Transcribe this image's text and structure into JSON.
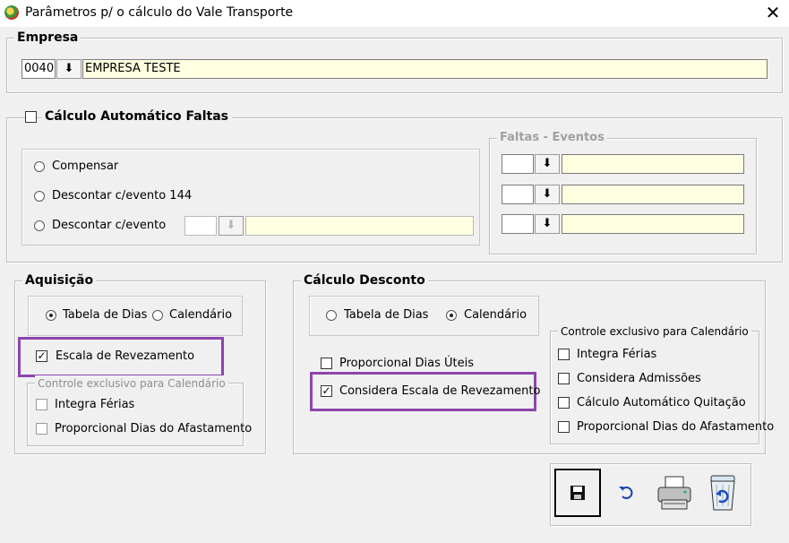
{
  "window": {
    "title": "Parâmetros p/ o cálculo do Vale Transporte",
    "close_glyph": "✕"
  },
  "empresa": {
    "legend": "Empresa",
    "code": "0040",
    "name": "EMPRESA TESTE",
    "lookup_icon": "⬇"
  },
  "faltas": {
    "checkbox_label": "Cálculo Automático Faltas",
    "checked": false,
    "options": [
      "Compensar",
      "Descontar c/evento 144",
      "Descontar c/evento"
    ],
    "eventos_legend": "Faltas - Eventos"
  },
  "aquisicao": {
    "legend": "Aquisição",
    "option_tabela": "Tabela de Dias",
    "option_calendario": "Calendário",
    "selected": "Tabela de Dias",
    "escala_label": "Escala de Revezamento",
    "escala_checked": true,
    "controle_legend": "Controle exclusivo para Calendário",
    "integra_ferias": "Integra Férias",
    "proporcional_afastamento": "Proporcional Dias do Afastamento"
  },
  "calculo_desconto": {
    "legend": "Cálculo Desconto",
    "option_tabela": "Tabela de Dias",
    "option_calendario": "Calendário",
    "selected": "Calendário",
    "proporcional_uteis": "Proporcional Dias Úteis",
    "considera_escala": "Considera Escala de Revezamento",
    "considera_escala_checked": true,
    "controle_legend": "Controle exclusivo para Calendário",
    "integra_ferias": "Integra Férias",
    "considera_admissoes": "Considera Admissões",
    "calculo_quitacao": "Cálculo Automático Quitação",
    "proporcional_afastamento": "Proporcional Dias do Afastamento"
  },
  "toolbar": {
    "save": "save-icon",
    "undo": "undo-icon",
    "print": "printer-icon",
    "recycle": "recycle-bin-icon"
  },
  "colors": {
    "highlight": "#8e44ad",
    "field_yellow": "#ffffe1",
    "background": "#f0f0f0"
  }
}
